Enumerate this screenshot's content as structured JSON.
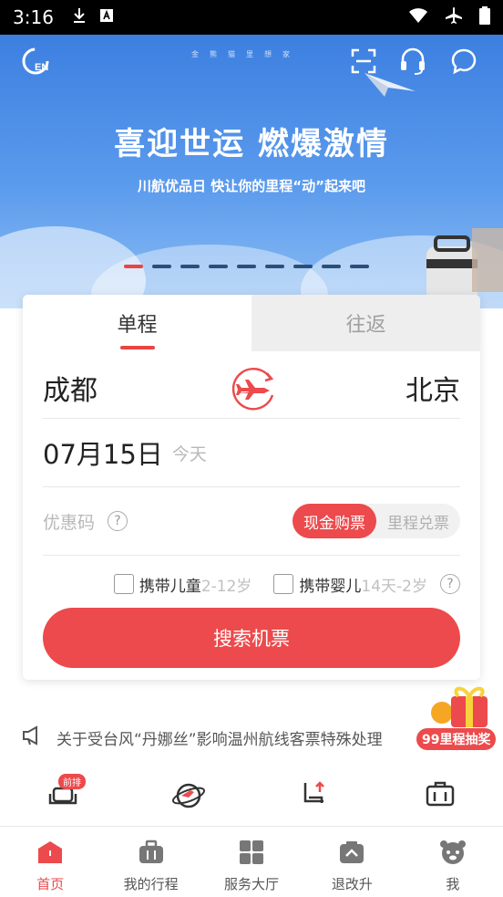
{
  "status": {
    "time": "3:16"
  },
  "banner": {
    "slogan": "喜迎世运 燃爆激情",
    "subtitle": "川航优品日 快让你的里程“动”起来吧",
    "brand": "金熊猫里想家"
  },
  "booking": {
    "tabs": [
      "单程",
      "往返"
    ],
    "active_tab": "单程",
    "from_city": "成都",
    "to_city": "北京",
    "date": "07月15日",
    "date_note": "今天",
    "promo_label": "优惠码",
    "pay_options": [
      "现金购票",
      "里程兑票"
    ],
    "child_label": "携带儿童",
    "child_age": "2-12岁",
    "infant_label": "携带婴儿",
    "infant_age": "14天-2岁",
    "search_label": "搜索机票"
  },
  "notice": {
    "text": "关于受台风“丹娜丝”影响温州航线客票特殊处理"
  },
  "lottery": {
    "label": "99里程抽奖"
  },
  "shortcuts": {
    "badge": "前排"
  },
  "nav": {
    "items": [
      "首页",
      "我的行程",
      "服务大厅",
      "退改升",
      "我"
    ],
    "active": "首页"
  },
  "colors": {
    "accent": "#ec4a4c",
    "banner": "#4a8be6"
  }
}
